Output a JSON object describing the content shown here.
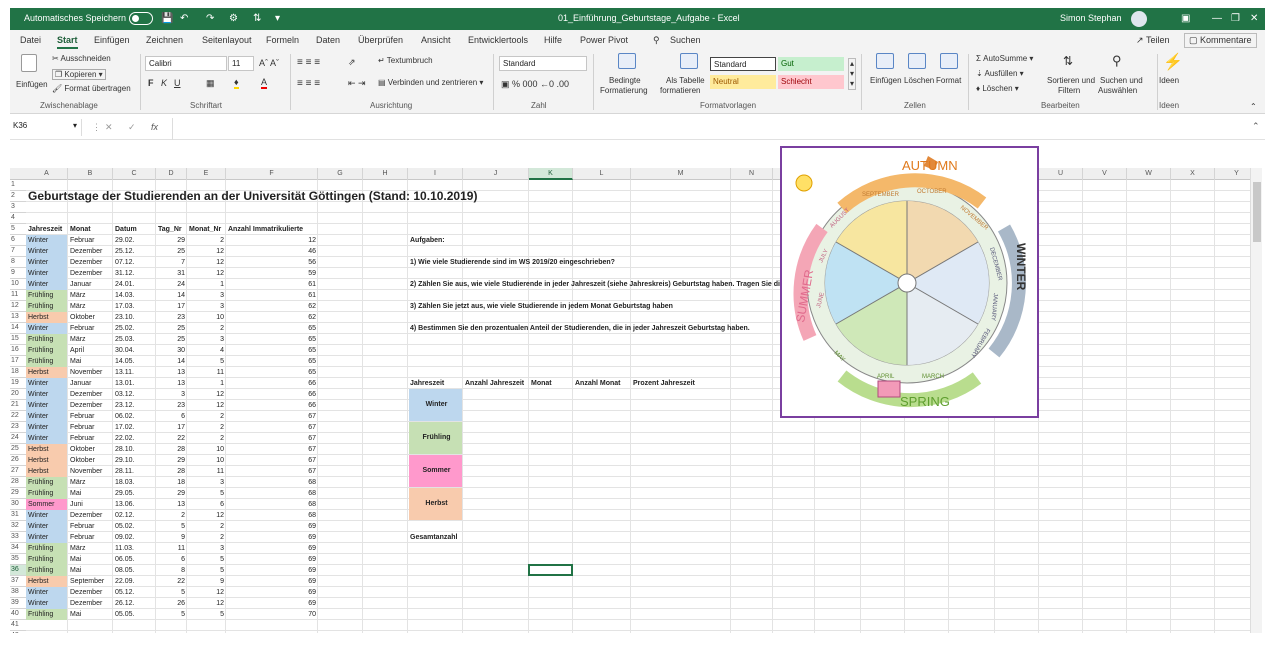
{
  "app": {
    "autosave_label": "Automatisches Speichern",
    "title": "01_Einführung_Geburtstage_Aufgabe - Excel",
    "user": "Simon Stephan"
  },
  "menu": {
    "items": [
      "Datei",
      "Start",
      "Einfügen",
      "Zeichnen",
      "Seitenlayout",
      "Formeln",
      "Daten",
      "Überprüfen",
      "Ansicht",
      "Entwicklertools",
      "Hilfe",
      "Power Pivot"
    ],
    "search": "Suchen",
    "share": "Teilen",
    "comments": "Kommentare"
  },
  "ribbon": {
    "clipboard": {
      "paste": "Einfügen",
      "cut": "Ausschneiden",
      "copy": "Kopieren",
      "format_painter": "Format übertragen",
      "group": "Zwischenablage"
    },
    "font": {
      "name": "Calibri",
      "size": "11",
      "group": "Schriftart"
    },
    "alignment": {
      "wrap": "Textumbruch",
      "merge": "Verbinden und zentrieren",
      "group": "Ausrichtung"
    },
    "number": {
      "format": "Standard",
      "group": "Zahl"
    },
    "styles": {
      "cond": "Bedingte",
      "cond2": "Formatierung",
      "table": "Als Tabelle",
      "table2": "formatieren",
      "standard": "Standard",
      "gut": "Gut",
      "neutral": "Neutral",
      "schlecht": "Schlecht",
      "group": "Formatvorlagen"
    },
    "cells": {
      "insert": "Einfügen",
      "delete": "Löschen",
      "format": "Format",
      "group": "Zellen"
    },
    "editing": {
      "autosum": "AutoSumme",
      "fill": "Ausfüllen",
      "clear": "Löschen",
      "sort": "Sortieren und",
      "sort2": "Filtern",
      "find": "Suchen und",
      "find2": "Auswählen",
      "group": "Bearbeiten"
    },
    "ideas": {
      "label": "Ideen",
      "group": "Ideen"
    }
  },
  "formula_bar": {
    "name_box": "K36",
    "fx": "fx",
    "value": ""
  },
  "sheet": {
    "columns": [
      "A",
      "B",
      "C",
      "D",
      "E",
      "F",
      "G",
      "H",
      "I",
      "J",
      "K",
      "L",
      "M",
      "N",
      "O",
      "P",
      "Q",
      "R",
      "S",
      "T",
      "U",
      "V",
      "W",
      "X",
      "Y"
    ],
    "selected_column": "K",
    "selected_row": "36",
    "title": "Geburtstage der Studierenden an der Universität Göttingen (Stand: 10.10.2019)",
    "headers": [
      "Jahreszeit",
      "Monat",
      "Datum",
      "Tag_Nr",
      "Monat_Nr",
      "Anzahl Immatrikulierte"
    ],
    "rows": [
      [
        "6",
        "Winter",
        "Februar",
        "29.02.",
        "29",
        "2",
        "12"
      ],
      [
        "7",
        "Winter",
        "Dezember",
        "25.12.",
        "25",
        "12",
        "46"
      ],
      [
        "8",
        "Winter",
        "Dezember",
        "07.12.",
        "7",
        "12",
        "56"
      ],
      [
        "9",
        "Winter",
        "Dezember",
        "31.12.",
        "31",
        "12",
        "59"
      ],
      [
        "10",
        "Winter",
        "Januar",
        "24.01.",
        "24",
        "1",
        "61"
      ],
      [
        "11",
        "Frühling",
        "März",
        "14.03.",
        "14",
        "3",
        "61"
      ],
      [
        "12",
        "Frühling",
        "März",
        "17.03.",
        "17",
        "3",
        "62"
      ],
      [
        "13",
        "Herbst",
        "Oktober",
        "23.10.",
        "23",
        "10",
        "62"
      ],
      [
        "14",
        "Winter",
        "Februar",
        "25.02.",
        "25",
        "2",
        "65"
      ],
      [
        "15",
        "Frühling",
        "März",
        "25.03.",
        "25",
        "3",
        "65"
      ],
      [
        "16",
        "Frühling",
        "April",
        "30.04.",
        "30",
        "4",
        "65"
      ],
      [
        "17",
        "Frühling",
        "Mai",
        "14.05.",
        "14",
        "5",
        "65"
      ],
      [
        "18",
        "Herbst",
        "November",
        "13.11.",
        "13",
        "11",
        "65"
      ],
      [
        "19",
        "Winter",
        "Januar",
        "13.01.",
        "13",
        "1",
        "66"
      ],
      [
        "20",
        "Winter",
        "Dezember",
        "03.12.",
        "3",
        "12",
        "66"
      ],
      [
        "21",
        "Winter",
        "Dezember",
        "23.12.",
        "23",
        "12",
        "66"
      ],
      [
        "22",
        "Winter",
        "Februar",
        "06.02.",
        "6",
        "2",
        "67"
      ],
      [
        "23",
        "Winter",
        "Februar",
        "17.02.",
        "17",
        "2",
        "67"
      ],
      [
        "24",
        "Winter",
        "Februar",
        "22.02.",
        "22",
        "2",
        "67"
      ],
      [
        "25",
        "Herbst",
        "Oktober",
        "28.10.",
        "28",
        "10",
        "67"
      ],
      [
        "26",
        "Herbst",
        "Oktober",
        "29.10.",
        "29",
        "10",
        "67"
      ],
      [
        "27",
        "Herbst",
        "November",
        "28.11.",
        "28",
        "11",
        "67"
      ],
      [
        "28",
        "Frühling",
        "März",
        "18.03.",
        "18",
        "3",
        "68"
      ],
      [
        "29",
        "Frühling",
        "Mai",
        "29.05.",
        "29",
        "5",
        "68"
      ],
      [
        "30",
        "Sommer",
        "Juni",
        "13.06.",
        "13",
        "6",
        "68"
      ],
      [
        "31",
        "Winter",
        "Dezember",
        "02.12.",
        "2",
        "12",
        "68"
      ],
      [
        "32",
        "Winter",
        "Februar",
        "05.02.",
        "5",
        "2",
        "69"
      ],
      [
        "33",
        "Winter",
        "Februar",
        "09.02.",
        "9",
        "2",
        "69"
      ],
      [
        "34",
        "Frühling",
        "März",
        "11.03.",
        "11",
        "3",
        "69"
      ],
      [
        "35",
        "Frühling",
        "Mai",
        "06.05.",
        "6",
        "5",
        "69"
      ],
      [
        "36",
        "Frühling",
        "Mai",
        "08.05.",
        "8",
        "5",
        "69"
      ],
      [
        "37",
        "Herbst",
        "September",
        "22.09.",
        "22",
        "9",
        "69"
      ],
      [
        "38",
        "Winter",
        "Dezember",
        "05.12.",
        "5",
        "12",
        "69"
      ],
      [
        "39",
        "Winter",
        "Dezember",
        "26.12.",
        "26",
        "12",
        "69"
      ],
      [
        "40",
        "Frühling",
        "Mai",
        "05.05.",
        "5",
        "5",
        "70"
      ]
    ],
    "tasks": {
      "heading": "Aufgaben:",
      "t1": "1) Wie viele Studierende sind im WS 2019/20 eingeschrieben?",
      "t2": "2) Zählen Sie aus, wie viele Studierende in jeder Jahreszeit (siehe Jahreskreis) Geburtstag haben. Tragen Sie die Ergebnisse in die unten stehende Tabelle ein.",
      "t3": "3) Zählen Sie jetzt aus, wie viele Studierende in jedem Monat Geburtstag haben",
      "t4": "4) Bestimmen Sie den prozentualen Anteil der Studierenden, die in jeder Jahreszeit Geburtstag haben."
    },
    "summary": {
      "headers": [
        "Jahreszeit",
        "Anzahl Jahreszeit",
        "Monat",
        "Anzahl Monat",
        "Prozent Jahreszeit"
      ],
      "seasons": [
        "Winter",
        "Frühling",
        "Sommer",
        "Herbst"
      ],
      "total": "Gesamtanzahl"
    },
    "season_colors": {
      "Winter": "#bdd7ee",
      "Frühling": "#c6e0b4",
      "Sommer": "#ff99cc",
      "Herbst": "#f8cbad"
    }
  },
  "image": {
    "seasons": [
      "AUTUMN",
      "WINTER",
      "SPRING",
      "SUMMER"
    ],
    "months": [
      "SEPTEMBER",
      "OCTOBER",
      "NOVEMBER",
      "DECEMBER",
      "JANUARY",
      "FEBRUARY",
      "MARCH",
      "APRIL",
      "MAY",
      "JUNE",
      "JULY",
      "AUGUST"
    ]
  }
}
